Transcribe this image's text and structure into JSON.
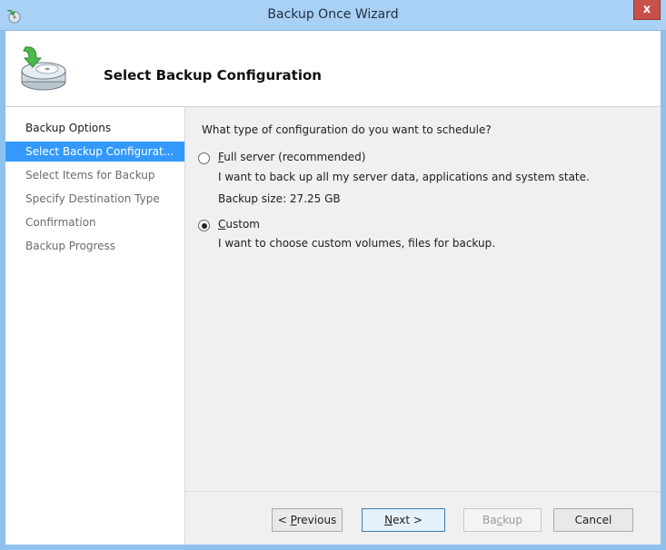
{
  "window": {
    "title": "Backup Once Wizard",
    "close_label": "x"
  },
  "header": {
    "title": "Select Backup Configuration"
  },
  "steps": [
    {
      "label": "Backup Options",
      "state": "done"
    },
    {
      "label": "Select Backup Configurat...",
      "state": "active"
    },
    {
      "label": "Select Items for Backup",
      "state": "pending"
    },
    {
      "label": "Specify Destination Type",
      "state": "pending"
    },
    {
      "label": "Confirmation",
      "state": "pending"
    },
    {
      "label": "Backup Progress",
      "state": "pending"
    }
  ],
  "content": {
    "question": "What type of configuration do you want to schedule?",
    "full": {
      "access": "F",
      "label_rest": "ull server (recommended)",
      "selected": false,
      "desc": "I want to back up all my server data, applications and system state.",
      "size": "Backup size: 27.25 GB"
    },
    "custom": {
      "access": "C",
      "label_rest": "ustom",
      "selected": true,
      "desc": "I want to choose custom volumes, files for backup."
    }
  },
  "buttons": {
    "previous": {
      "prefix": "< ",
      "access": "P",
      "rest": "revious"
    },
    "next": {
      "access": "N",
      "rest": "ext >"
    },
    "backup": {
      "prefix": "Ba",
      "access": "c",
      "rest": "kup",
      "enabled": false
    },
    "cancel": {
      "label": "Cancel"
    }
  },
  "colors": {
    "selection": "#3399ff",
    "frame": "#8fc1ee",
    "close": "#c7504a"
  }
}
